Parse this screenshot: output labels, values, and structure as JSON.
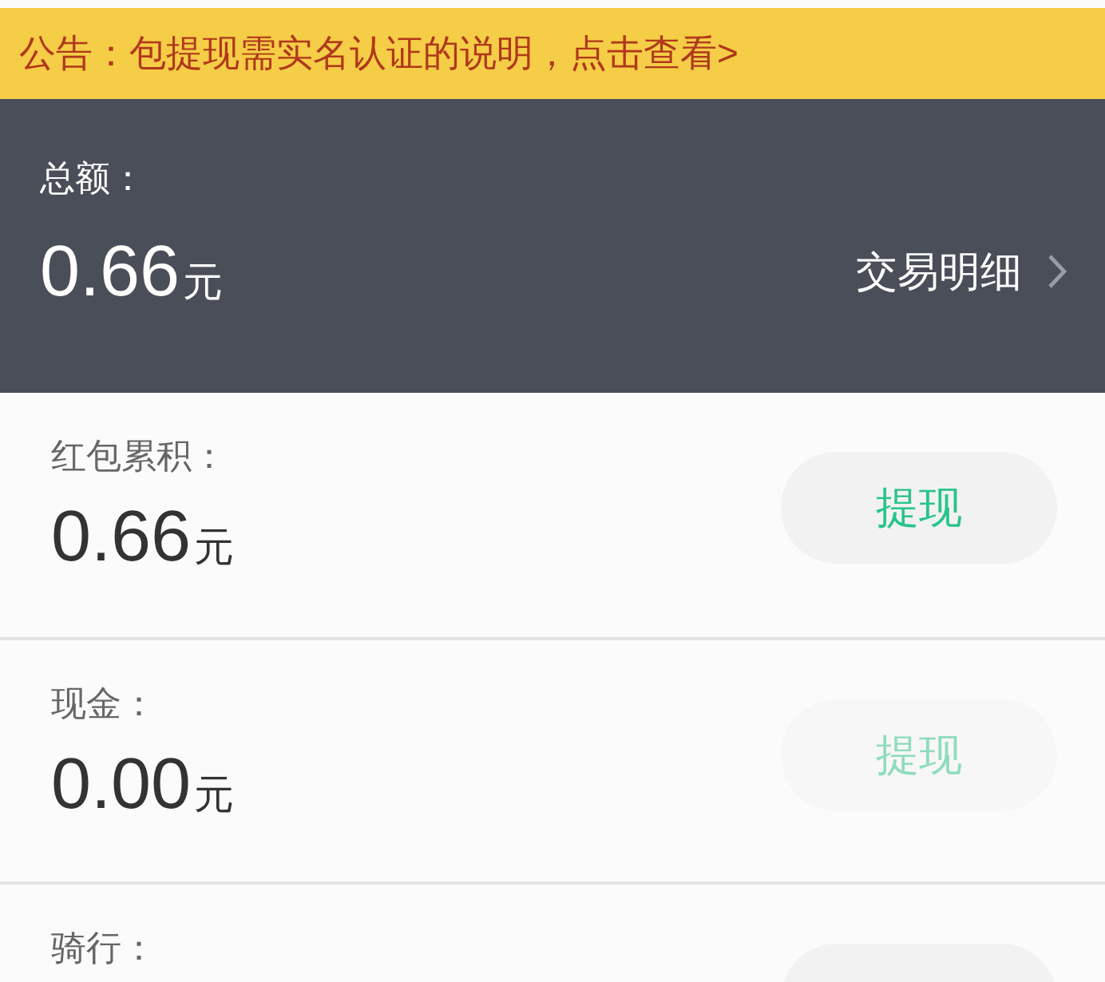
{
  "notice": {
    "text": "公告：包提现需实名认证的说明，点击查看>"
  },
  "summary": {
    "label": "总额：",
    "amount": "0.66",
    "unit": "元",
    "details_link": "交易明细"
  },
  "accounts": [
    {
      "label": "红包累积：",
      "amount": "0.66",
      "unit": "元",
      "button": {
        "label": "提现",
        "disabled": false
      }
    },
    {
      "label": "现金：",
      "amount": "0.00",
      "unit": "元",
      "button": {
        "label": "提现",
        "disabled": true
      }
    },
    {
      "label": "骑行："
    }
  ]
}
